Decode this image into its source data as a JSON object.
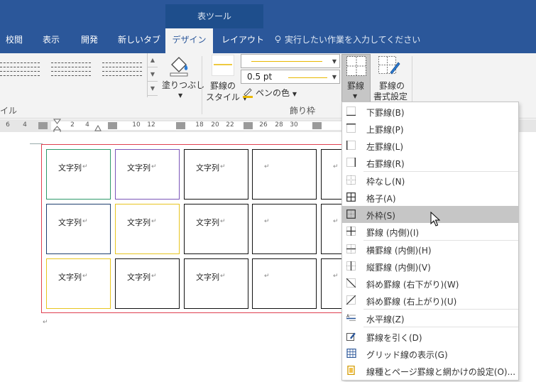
{
  "title_bar": {
    "context_title": "表ツール"
  },
  "tabs": [
    "校閲",
    "表示",
    "開発",
    "新しいタブ",
    "デザイン",
    "レイアウト"
  ],
  "tell_me": "実行したい作業を入力してください",
  "ribbon": {
    "shading_label": "塗りつぶし",
    "border_style_label_1": "罫線の",
    "border_style_label_2": "スタイル",
    "pen_weight": "0.5 pt",
    "pen_color_label": "ペンの色",
    "borders_label": "罫線",
    "border_painter_label_1": "罫線の",
    "border_painter_label_2": "書式設定",
    "group_styles_tail": "イル",
    "group_borders": "飾り枠"
  },
  "ruler": {
    "numbers": [
      "6",
      "4",
      "2",
      "4",
      "10",
      "12",
      "18",
      "20",
      "22",
      "26",
      "28",
      "30"
    ]
  },
  "table": {
    "cell_text": "文字列",
    "rows": [
      [
        "文字列",
        "文字列",
        "文字列",
        "",
        ""
      ],
      [
        "文字列",
        "文字列",
        "文字列",
        "",
        ""
      ],
      [
        "文字列",
        "文字列",
        "文字列",
        "",
        ""
      ]
    ],
    "cell_mark": "↵"
  },
  "menu": {
    "items": [
      "下罫線(B)",
      "上罫線(P)",
      "左罫線(L)",
      "右罫線(R)",
      "枠なし(N)",
      "格子(A)",
      "外枠(S)",
      "罫線 (内側)(I)",
      "横罫線 (内側)(H)",
      "縦罫線 (内側)(V)",
      "斜め罫線 (右下がり)(W)",
      "斜め罫線 (右上がり)(U)",
      "水平線(Z)",
      "罫線を引く(D)",
      "グリッド線の表示(G)",
      "線種とページ罫線と網かけの設定(O)..."
    ],
    "highlighted": "外枠(S)"
  },
  "colors": {
    "accent": "#2b579a",
    "table_outline": "#e04050"
  }
}
